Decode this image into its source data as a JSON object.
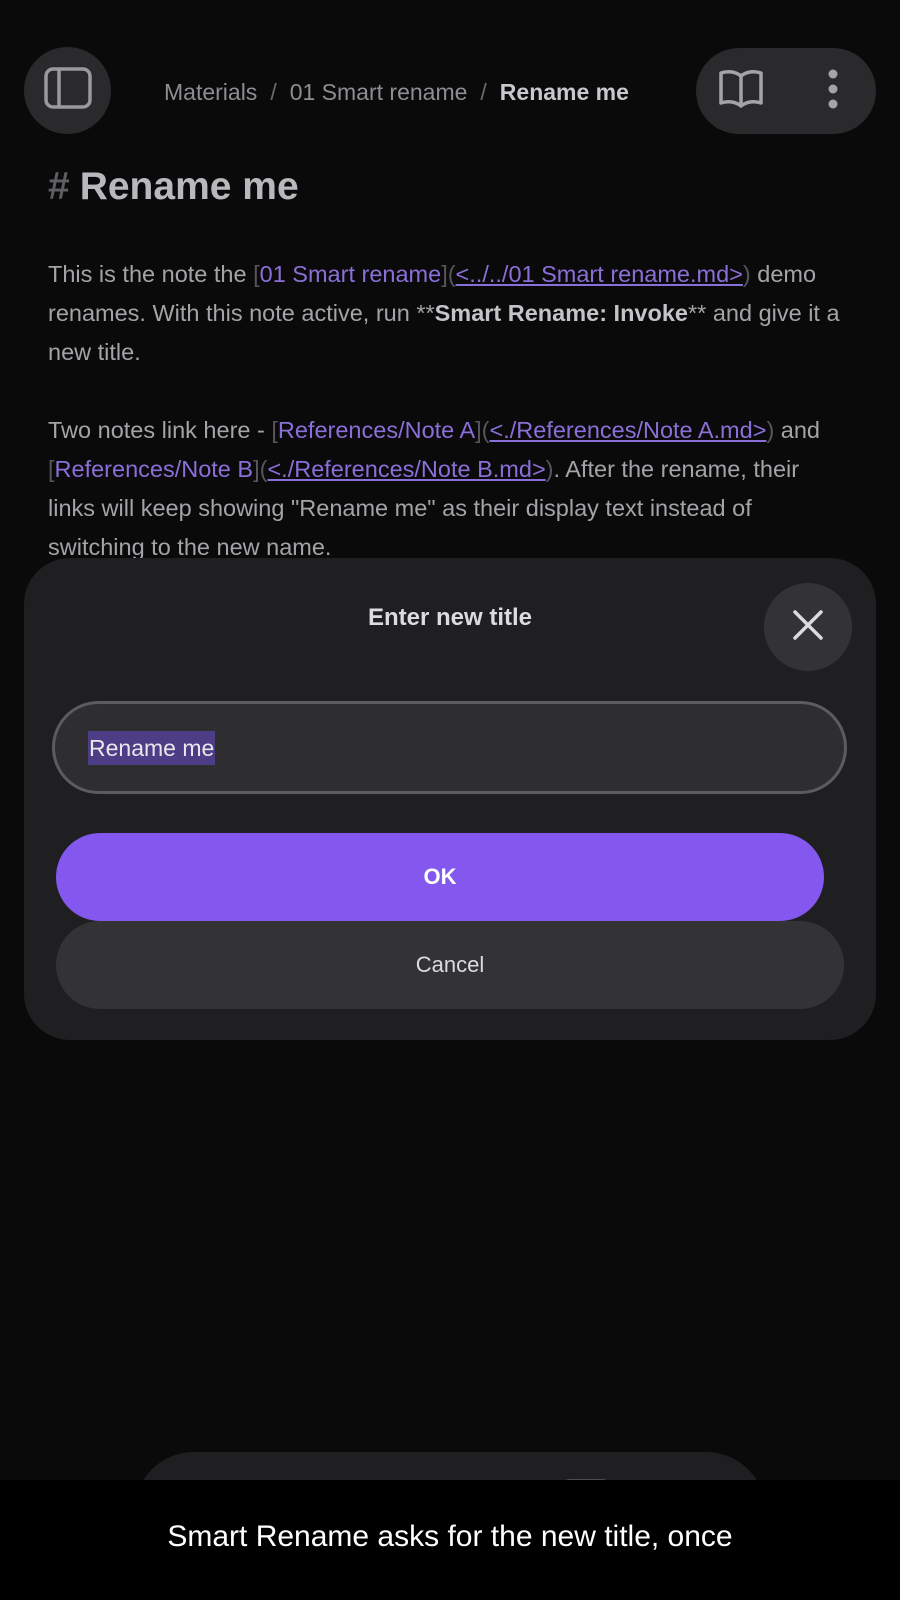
{
  "breadcrumb": {
    "items": [
      "Materials",
      "01 Smart rename"
    ],
    "separator": "/",
    "current": "Rename me"
  },
  "note": {
    "heading_marker": "#",
    "title": "Rename me",
    "p1": {
      "text1": "This is the note the ",
      "link_open": "[",
      "link_text": "01 Smart rename",
      "link_mid": "](",
      "link_url": "<../../01 Smart rename.md>",
      "link_close": ")",
      "text2": " demo renames. With this note active, run ",
      "bold_marker_open": "**",
      "bold_text": "Smart Rename: Invoke",
      "bold_marker_close": "**",
      "text3": " and give it a new title."
    },
    "p2": {
      "text1": "Two notes link here - ",
      "link1_open": "[",
      "link1_text": "References/Note A",
      "link1_mid": "](",
      "link1_url": "<./References/Note A.md>",
      "link1_close": ")",
      "text2": " and ",
      "link2_open": "[",
      "link2_text": "References/Note B",
      "link2_mid": "](",
      "link2_url": "<./References/Note B.md>",
      "link2_close": ")",
      "text3": ". After the rename, their links will keep showing \"Rename me\" as their display text instead of switching to the new name."
    }
  },
  "modal": {
    "title": "Enter new title",
    "input_value": "Rename me",
    "ok_label": "OK",
    "cancel_label": "Cancel"
  },
  "caption": "Smart Rename asks for the new title, once",
  "icons": {
    "sidebar": "sidebar-toggle-icon",
    "book": "reading-view-icon",
    "more": "more-vertical-icon",
    "close": "close-icon",
    "back": "chevron-left-icon",
    "search": "search-icon",
    "new": "plus-icon",
    "tabs": "tabs-icon",
    "menu": "menu-icon"
  },
  "colors": {
    "accent": "#8458ee",
    "link": "#8b6fd8",
    "background": "#0a0a0b",
    "modal": "#1f1f21"
  }
}
